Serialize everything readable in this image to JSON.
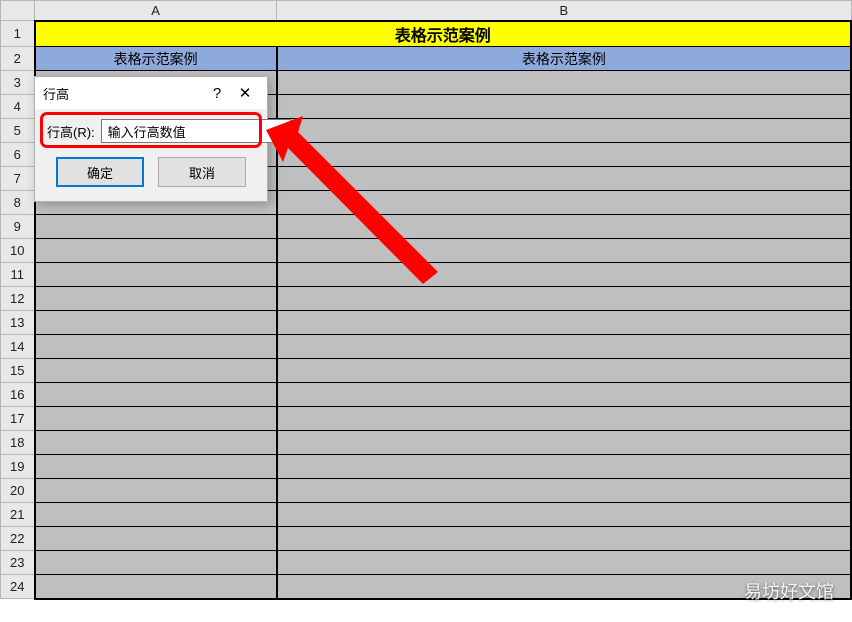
{
  "columns": {
    "A": "A",
    "B": "B"
  },
  "rows": [
    "1",
    "2",
    "3",
    "4",
    "5",
    "6",
    "7",
    "8",
    "9",
    "10",
    "11",
    "12",
    "13",
    "14",
    "15",
    "16",
    "17",
    "18",
    "19",
    "20",
    "21",
    "22",
    "23",
    "24"
  ],
  "header_merged": "表格示范案例",
  "subheader": {
    "A": "表格示范案例",
    "B": "表格示范案例"
  },
  "dialog": {
    "title": "行高",
    "help": "?",
    "close": "✕",
    "label": "行高(R):",
    "value": "输入行高数值",
    "ok": "确定",
    "cancel": "取消"
  },
  "watermark": "易坊好文馆"
}
